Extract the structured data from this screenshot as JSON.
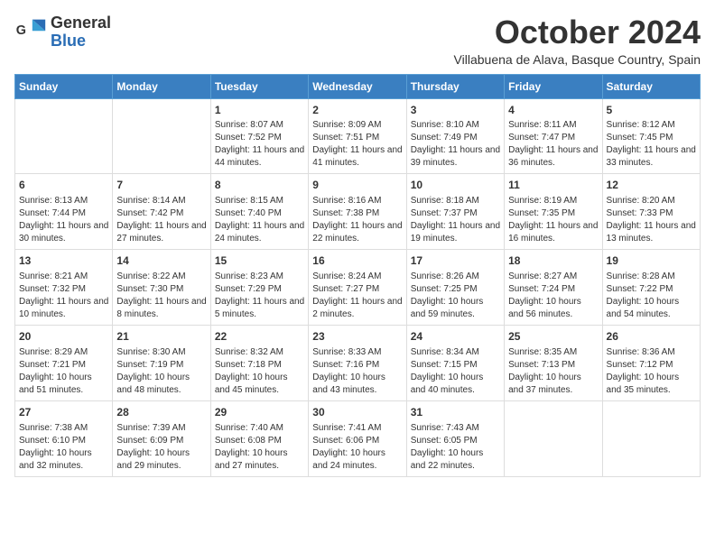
{
  "logo": {
    "general": "General",
    "blue": "Blue"
  },
  "header": {
    "month": "October 2024",
    "location": "Villabuena de Alava, Basque Country, Spain"
  },
  "weekdays": [
    "Sunday",
    "Monday",
    "Tuesday",
    "Wednesday",
    "Thursday",
    "Friday",
    "Saturday"
  ],
  "weeks": [
    [
      {
        "day": "",
        "info": ""
      },
      {
        "day": "",
        "info": ""
      },
      {
        "day": "1",
        "info": "Sunrise: 8:07 AM\nSunset: 7:52 PM\nDaylight: 11 hours and 44 minutes."
      },
      {
        "day": "2",
        "info": "Sunrise: 8:09 AM\nSunset: 7:51 PM\nDaylight: 11 hours and 41 minutes."
      },
      {
        "day": "3",
        "info": "Sunrise: 8:10 AM\nSunset: 7:49 PM\nDaylight: 11 hours and 39 minutes."
      },
      {
        "day": "4",
        "info": "Sunrise: 8:11 AM\nSunset: 7:47 PM\nDaylight: 11 hours and 36 minutes."
      },
      {
        "day": "5",
        "info": "Sunrise: 8:12 AM\nSunset: 7:45 PM\nDaylight: 11 hours and 33 minutes."
      }
    ],
    [
      {
        "day": "6",
        "info": "Sunrise: 8:13 AM\nSunset: 7:44 PM\nDaylight: 11 hours and 30 minutes."
      },
      {
        "day": "7",
        "info": "Sunrise: 8:14 AM\nSunset: 7:42 PM\nDaylight: 11 hours and 27 minutes."
      },
      {
        "day": "8",
        "info": "Sunrise: 8:15 AM\nSunset: 7:40 PM\nDaylight: 11 hours and 24 minutes."
      },
      {
        "day": "9",
        "info": "Sunrise: 8:16 AM\nSunset: 7:38 PM\nDaylight: 11 hours and 22 minutes."
      },
      {
        "day": "10",
        "info": "Sunrise: 8:18 AM\nSunset: 7:37 PM\nDaylight: 11 hours and 19 minutes."
      },
      {
        "day": "11",
        "info": "Sunrise: 8:19 AM\nSunset: 7:35 PM\nDaylight: 11 hours and 16 minutes."
      },
      {
        "day": "12",
        "info": "Sunrise: 8:20 AM\nSunset: 7:33 PM\nDaylight: 11 hours and 13 minutes."
      }
    ],
    [
      {
        "day": "13",
        "info": "Sunrise: 8:21 AM\nSunset: 7:32 PM\nDaylight: 11 hours and 10 minutes."
      },
      {
        "day": "14",
        "info": "Sunrise: 8:22 AM\nSunset: 7:30 PM\nDaylight: 11 hours and 8 minutes."
      },
      {
        "day": "15",
        "info": "Sunrise: 8:23 AM\nSunset: 7:29 PM\nDaylight: 11 hours and 5 minutes."
      },
      {
        "day": "16",
        "info": "Sunrise: 8:24 AM\nSunset: 7:27 PM\nDaylight: 11 hours and 2 minutes."
      },
      {
        "day": "17",
        "info": "Sunrise: 8:26 AM\nSunset: 7:25 PM\nDaylight: 10 hours and 59 minutes."
      },
      {
        "day": "18",
        "info": "Sunrise: 8:27 AM\nSunset: 7:24 PM\nDaylight: 10 hours and 56 minutes."
      },
      {
        "day": "19",
        "info": "Sunrise: 8:28 AM\nSunset: 7:22 PM\nDaylight: 10 hours and 54 minutes."
      }
    ],
    [
      {
        "day": "20",
        "info": "Sunrise: 8:29 AM\nSunset: 7:21 PM\nDaylight: 10 hours and 51 minutes."
      },
      {
        "day": "21",
        "info": "Sunrise: 8:30 AM\nSunset: 7:19 PM\nDaylight: 10 hours and 48 minutes."
      },
      {
        "day": "22",
        "info": "Sunrise: 8:32 AM\nSunset: 7:18 PM\nDaylight: 10 hours and 45 minutes."
      },
      {
        "day": "23",
        "info": "Sunrise: 8:33 AM\nSunset: 7:16 PM\nDaylight: 10 hours and 43 minutes."
      },
      {
        "day": "24",
        "info": "Sunrise: 8:34 AM\nSunset: 7:15 PM\nDaylight: 10 hours and 40 minutes."
      },
      {
        "day": "25",
        "info": "Sunrise: 8:35 AM\nSunset: 7:13 PM\nDaylight: 10 hours and 37 minutes."
      },
      {
        "day": "26",
        "info": "Sunrise: 8:36 AM\nSunset: 7:12 PM\nDaylight: 10 hours and 35 minutes."
      }
    ],
    [
      {
        "day": "27",
        "info": "Sunrise: 7:38 AM\nSunset: 6:10 PM\nDaylight: 10 hours and 32 minutes."
      },
      {
        "day": "28",
        "info": "Sunrise: 7:39 AM\nSunset: 6:09 PM\nDaylight: 10 hours and 29 minutes."
      },
      {
        "day": "29",
        "info": "Sunrise: 7:40 AM\nSunset: 6:08 PM\nDaylight: 10 hours and 27 minutes."
      },
      {
        "day": "30",
        "info": "Sunrise: 7:41 AM\nSunset: 6:06 PM\nDaylight: 10 hours and 24 minutes."
      },
      {
        "day": "31",
        "info": "Sunrise: 7:43 AM\nSunset: 6:05 PM\nDaylight: 10 hours and 22 minutes."
      },
      {
        "day": "",
        "info": ""
      },
      {
        "day": "",
        "info": ""
      }
    ]
  ]
}
